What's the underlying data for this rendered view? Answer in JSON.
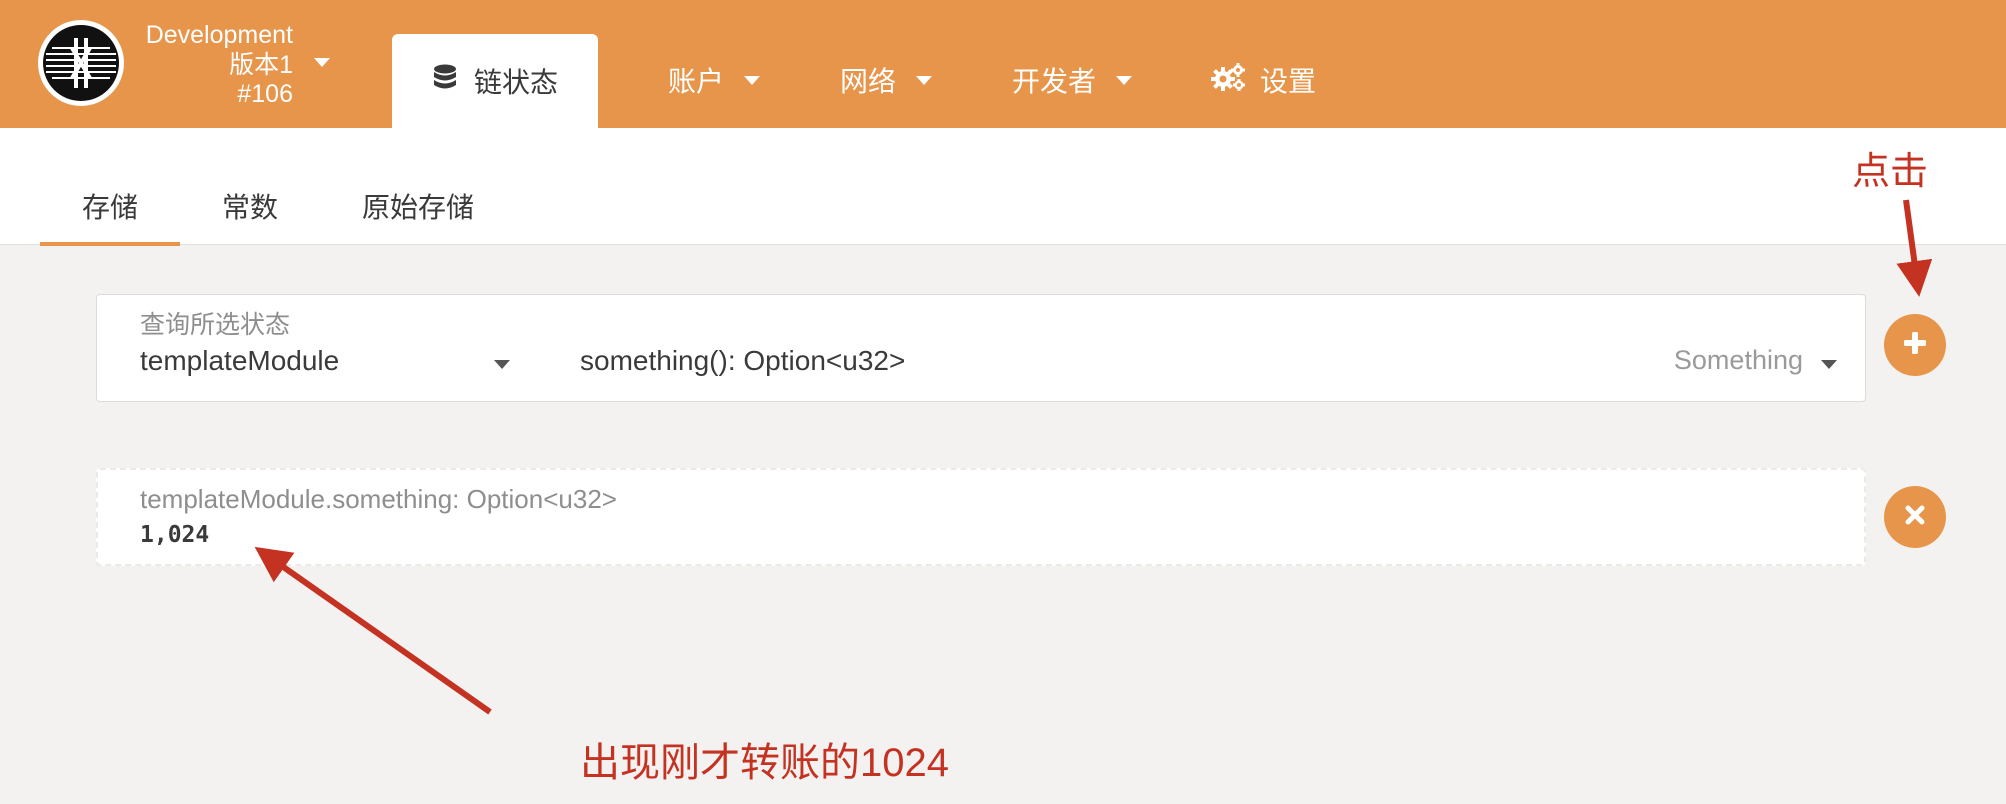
{
  "colors": {
    "accent": "#e6954a",
    "annotation": "#c43222",
    "background": "#f3f2f1"
  },
  "header": {
    "chain_name": "Development",
    "version": "版本1",
    "block": "#106",
    "nav": {
      "chain_state": "链状态",
      "accounts": "账户",
      "network": "网络",
      "developer": "开发者",
      "settings": "设置"
    },
    "icons": {
      "chain_state": "database-icon",
      "settings": "gears-icon"
    }
  },
  "subtabs": {
    "items": [
      "存储",
      "常数",
      "原始存储"
    ],
    "active": "存储"
  },
  "query": {
    "label": "查询所选状态",
    "module": "templateModule",
    "method": "something(): Option<u32>",
    "method_hint": "Something",
    "add_icon": "plus-icon"
  },
  "result": {
    "label": "templateModule.something: Option<u32>",
    "value": "1,024",
    "remove_icon": "close-icon"
  },
  "annotations": {
    "click_hint": "点击",
    "result_hint": "出现刚才转账的1024"
  }
}
